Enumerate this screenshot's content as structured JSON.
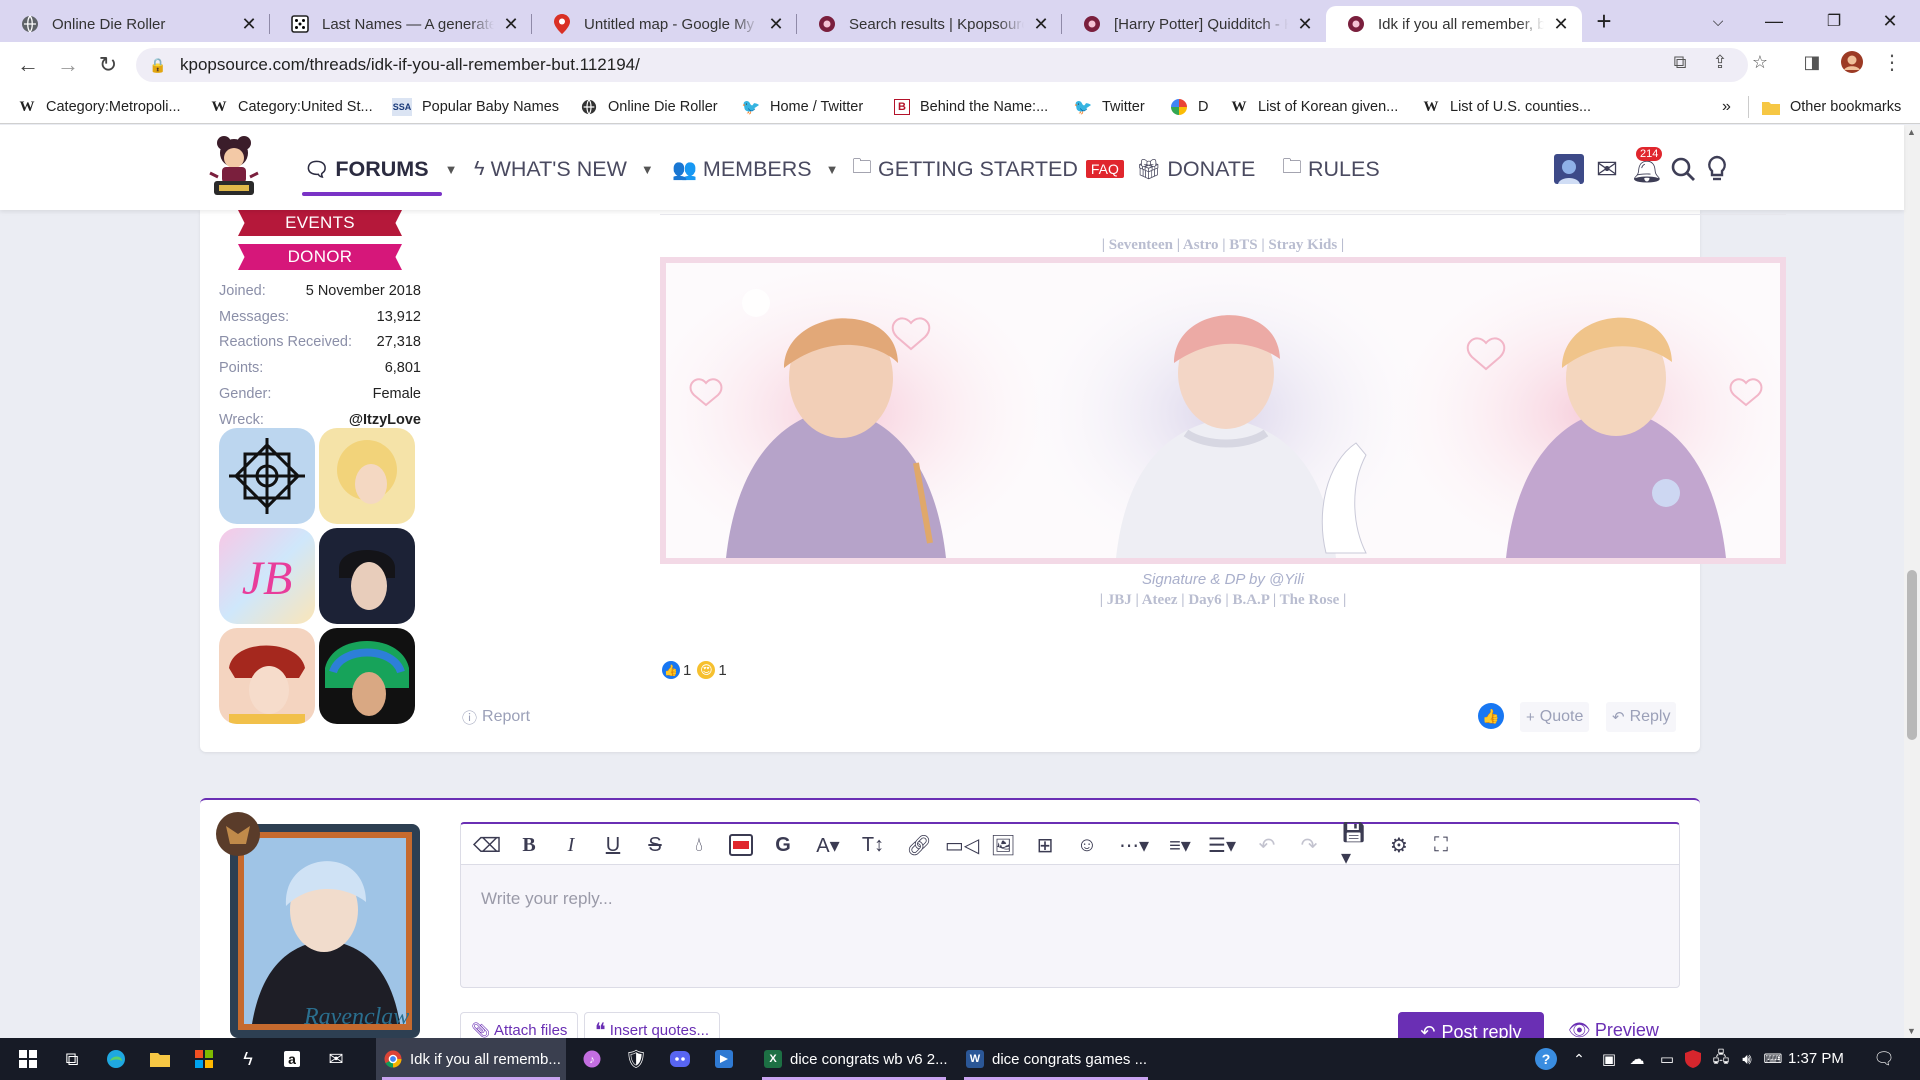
{
  "browser": {
    "tabs": [
      {
        "title": "Online Die Roller",
        "icon": "globe-icon"
      },
      {
        "title": "Last Names — A generated",
        "icon": "dice-icon"
      },
      {
        "title": "Untitled map - Google My M",
        "icon": "map-pin-icon"
      },
      {
        "title": "Search results | Kpopsource",
        "icon": "kpopsource-icon"
      },
      {
        "title": "[Harry Potter] Quidditch - K",
        "icon": "kpopsource-icon"
      },
      {
        "title": "Idk if you all remember, but",
        "icon": "kpopsource-icon",
        "active": true
      }
    ],
    "url": "kpopsource.com/threads/idk-if-you-all-remember-but.112194/",
    "bookmarks": [
      {
        "label": "Category:Metropoli...",
        "icon": "wikipedia-icon"
      },
      {
        "label": "Category:United St...",
        "icon": "wikipedia-icon"
      },
      {
        "label": "Popular Baby Names",
        "icon": "ssa-icon"
      },
      {
        "label": "Online Die Roller",
        "icon": "globe-icon"
      },
      {
        "label": "Home / Twitter",
        "icon": "twitter-icon"
      },
      {
        "label": "Behind the Name:...",
        "icon": "behindthename-icon"
      },
      {
        "label": "Twitter",
        "icon": "twitter-icon"
      },
      {
        "label": "D",
        "icon": "pinwheel-icon"
      },
      {
        "label": "List of Korean given...",
        "icon": "wikipedia-icon"
      },
      {
        "label": "List of U.S. counties...",
        "icon": "wikipedia-icon"
      }
    ],
    "bookmarks_overflow": "»",
    "other_bookmarks": "Other bookmarks"
  },
  "site": {
    "nav": {
      "forums": "FORUMS",
      "whats_new": "WHAT'S NEW",
      "members": "MEMBERS",
      "getting_started": "GETTING STARTED",
      "faq": "FAQ",
      "donate": "DONATE",
      "rules": "RULES"
    },
    "notification_count": "214"
  },
  "post": {
    "ribbons": [
      "EVENTS",
      "DONOR"
    ],
    "stats": [
      {
        "key": "Joined:",
        "value": "5 November 2018"
      },
      {
        "key": "Messages:",
        "value": "13,912"
      },
      {
        "key": "Reactions Received:",
        "value": "27,318"
      },
      {
        "key": "Points:",
        "value": "6,801"
      },
      {
        "key": "Gender:",
        "value": "Female"
      },
      {
        "key": "Wreck:",
        "value": "@ItzyLove"
      }
    ],
    "signature_top": "| Seventeen | Astro | BTS | Stray Kids |",
    "signature_credit": "Signature & DP by @Yili",
    "signature_groups": "| JBJ | Ateez | Day6 | B.A.P | The Rose |",
    "reactions": [
      {
        "icon": "like-icon",
        "count": "1"
      },
      {
        "icon": "heart-eyes-icon",
        "count": "1"
      }
    ],
    "report": "Report",
    "quote": "Quote",
    "reply": "Reply"
  },
  "editor": {
    "placeholder": "Write your reply...",
    "attach_files": "Attach files",
    "insert_quotes": "Insert quotes...",
    "post_reply": "Post reply",
    "preview": "Preview",
    "avatar_signature": "Ravenclaw"
  },
  "taskbar": {
    "tasks": [
      {
        "label": "Idk if you all rememb...",
        "icon": "chrome-icon"
      },
      {
        "label": "dice congrats wb v6 2...",
        "icon": "excel-icon"
      },
      {
        "label": "dice congrats games ...",
        "icon": "word-icon"
      }
    ],
    "time": "1:37 PM"
  },
  "colors": {
    "accent": "#6a2fb4",
    "events_ribbon": "#b5183a",
    "donor_ribbon": "#d6177a",
    "tab_strip": "#dad6f1"
  }
}
